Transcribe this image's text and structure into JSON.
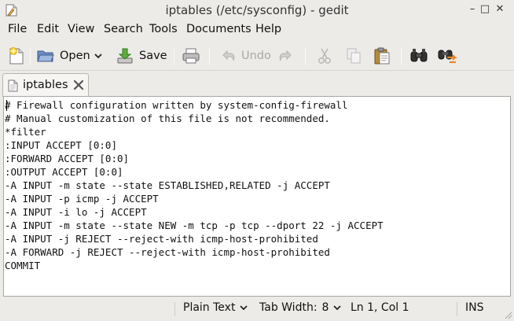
{
  "window": {
    "title": "iptables (/etc/sysconfig) - gedit",
    "controls": {
      "minimize": "–",
      "maximize": "□",
      "close": "✕"
    }
  },
  "menu": [
    "File",
    "Edit",
    "View",
    "Search",
    "Tools",
    "Documents",
    "Help"
  ],
  "toolbar": {
    "new_icon": "new-document-icon",
    "open_label": "Open",
    "save_label": "Save",
    "print_icon": "printer-icon",
    "undo_label": "Undo",
    "redo_icon": "redo-icon",
    "cut_icon": "scissors-icon",
    "copy_icon": "copy-icon",
    "paste_icon": "clipboard-icon",
    "find_icon": "binoculars-icon",
    "replace_icon": "find-replace-icon"
  },
  "tab": {
    "label": "iptables"
  },
  "editor": {
    "lines": [
      "# Firewall configuration written by system-config-firewall",
      "# Manual customization of this file is not recommended.",
      "*filter",
      ":INPUT ACCEPT [0:0]",
      ":FORWARD ACCEPT [0:0]",
      ":OUTPUT ACCEPT [0:0]",
      "-A INPUT -m state --state ESTABLISHED,RELATED -j ACCEPT",
      "-A INPUT -p icmp -j ACCEPT",
      "-A INPUT -i lo -j ACCEPT",
      "-A INPUT -m state --state NEW -m tcp -p tcp --dport 22 -j ACCEPT",
      "-A INPUT -j REJECT --reject-with icmp-host-prohibited",
      "-A FORWARD -j REJECT --reject-with icmp-host-prohibited",
      "COMMIT"
    ]
  },
  "status": {
    "language": "Plain Text",
    "tab_width_label": "Tab Width:",
    "tab_width": "8",
    "position": "Ln 1, Col 1",
    "mode": "INS"
  },
  "colors": {
    "background": "#ecebe8",
    "editor_bg": "#ffffff",
    "disabled": "#a9a8a4"
  }
}
